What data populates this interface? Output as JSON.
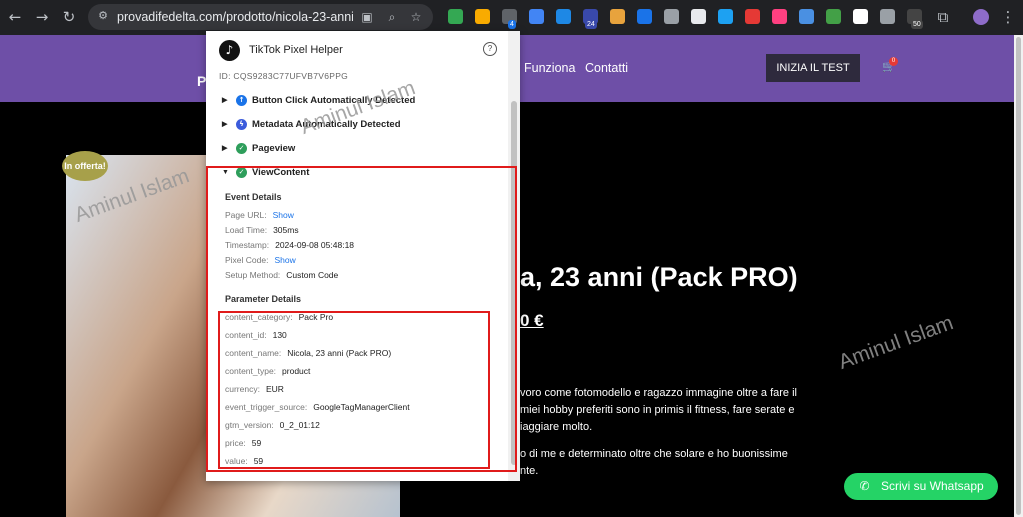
{
  "browser": {
    "url": "provadifedelta.com/prodotto/nicola-23-anni-pac...",
    "extension_badges": {
      "b1": "4",
      "b2": "24",
      "b3": "50"
    }
  },
  "site": {
    "logo": "P",
    "nav": [
      "Funziona",
      "Contatti"
    ],
    "cta": "INIZIA IL TEST",
    "cart_count": "0",
    "sale_badge": "In offerta!",
    "product_title_partial": "a, 23 anni (Pack PRO)",
    "price_partial": "0 €",
    "desc_lines": [
      "voro come fotomodello e ragazzo immagine oltre a fare il",
      "miei hobby preferiti sono in primis il fitness, fare serate e",
      "iaggiare molto.",
      "o di me e determinato oltre che solare e ho buonissime",
      "nte."
    ],
    "whatsapp": "Scrivi su Whatsapp"
  },
  "popup": {
    "title": "TikTok Pixel Helper",
    "pixel_id": "ID:  CQS9283C77UFVB7V6PPG",
    "events": [
      {
        "label": "Button Click Automatically Detected",
        "color": "#1a73e8",
        "icon": "arrow-up-icon"
      },
      {
        "label": "Metadata Automatically Detected",
        "color": "#3b5bdb",
        "icon": "bolt-icon"
      },
      {
        "label": "Pageview",
        "color": "#2e9e5b",
        "icon": "check-icon"
      },
      {
        "label": "ViewContent",
        "color": "#2e9e5b",
        "icon": "check-icon"
      }
    ],
    "event_details_title": "Event Details",
    "event_details": [
      {
        "k": "Page URL:",
        "v": "Show",
        "link": true
      },
      {
        "k": "Load Time:",
        "v": "305ms",
        "link": false
      },
      {
        "k": "Timestamp:",
        "v": "2024-09-08 05:48:18",
        "link": false
      },
      {
        "k": "Pixel Code:",
        "v": "Show",
        "link": true
      },
      {
        "k": "Setup Method:",
        "v": "Custom Code",
        "link": false
      }
    ],
    "parameter_details_title": "Parameter Details",
    "parameters": [
      {
        "k": "content_category:",
        "v": "Pack Pro"
      },
      {
        "k": "content_id:",
        "v": "130"
      },
      {
        "k": "content_name:",
        "v": "Nicola, 23 anni (Pack PRO)"
      },
      {
        "k": "content_type:",
        "v": "product"
      },
      {
        "k": "currency:",
        "v": "EUR"
      },
      {
        "k": "event_trigger_source:",
        "v": "GoogleTagManagerClient"
      },
      {
        "k": "gtm_version:",
        "v": "0_2_01:12"
      },
      {
        "k": "price:",
        "v": "59"
      },
      {
        "k": "value:",
        "v": "59"
      }
    ]
  },
  "watermark": "Aminul Islam",
  "colors": {
    "header": "#6e4fa7",
    "highlight": "#e01b1b",
    "whatsapp": "#25d366"
  }
}
